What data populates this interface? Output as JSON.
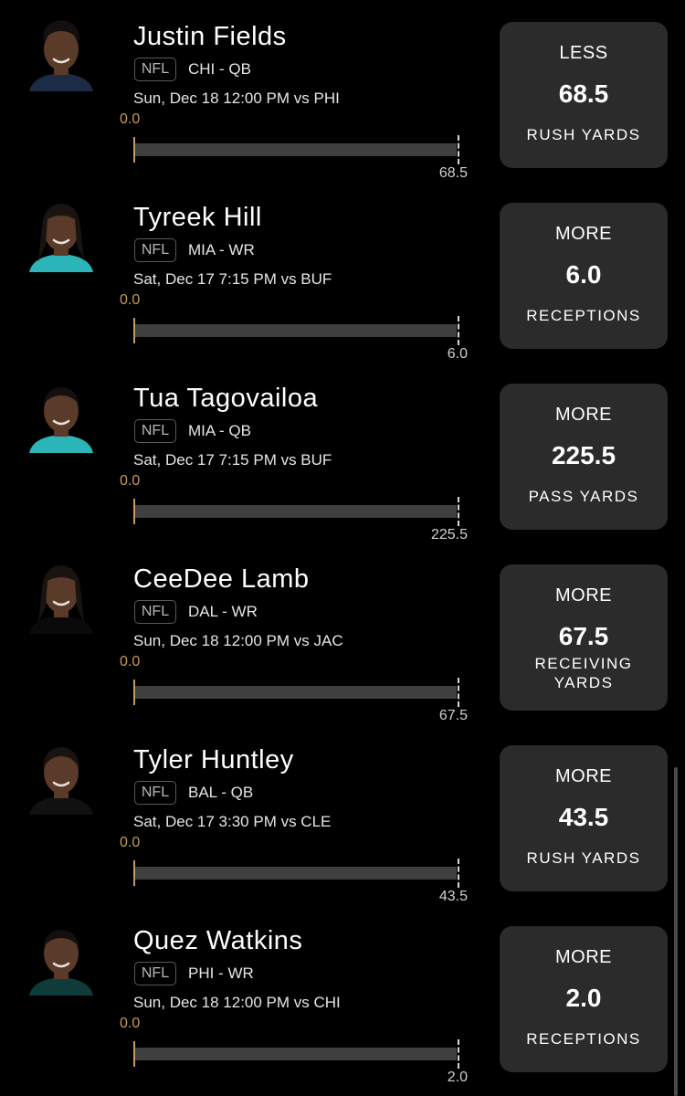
{
  "picks": [
    {
      "player": "Justin Fields",
      "league": "NFL",
      "team_position": "CHI - QB",
      "game": "Sun, Dec 18 12:00 PM  vs PHI",
      "current": "0.0",
      "target": "68.5",
      "progress": 0,
      "pick": "LESS",
      "line": "68.5",
      "stat": "RUSH YARDS",
      "jersey_color": "#1c2b46",
      "hair": "curly"
    },
    {
      "player": "Tyreek Hill",
      "league": "NFL",
      "team_position": "MIA - WR",
      "game": "Sat, Dec 17 7:15 PM  vs BUF",
      "current": "0.0",
      "target": "6.0",
      "progress": 0,
      "pick": "MORE",
      "line": "6.0",
      "stat": "RECEPTIONS",
      "jersey_color": "#2bb5b8",
      "hair": "locs"
    },
    {
      "player": "Tua Tagovailoa",
      "league": "NFL",
      "team_position": "MIA - QB",
      "game": "Sat, Dec 17 7:15 PM  vs BUF",
      "current": "0.0",
      "target": "225.5",
      "progress": 0,
      "pick": "MORE",
      "line": "225.5",
      "stat": "PASS YARDS",
      "jersey_color": "#2bb5b8",
      "hair": "short"
    },
    {
      "player": "CeeDee Lamb",
      "league": "NFL",
      "team_position": "DAL - WR",
      "game": "Sun, Dec 18 12:00 PM  vs JAC",
      "current": "0.0",
      "target": "67.5",
      "progress": 0,
      "pick": "MORE",
      "line": "67.5",
      "stat": "RECEIVING YARDS",
      "jersey_color": "#0a0a0a",
      "hair": "locs"
    },
    {
      "player": "Tyler Huntley",
      "league": "NFL",
      "team_position": "BAL - QB",
      "game": "Sat, Dec 17 3:30 PM  vs CLE",
      "current": "0.0",
      "target": "43.5",
      "progress": 0,
      "pick": "MORE",
      "line": "43.5",
      "stat": "RUSH YARDS",
      "jersey_color": "#111111",
      "hair": "braids"
    },
    {
      "player": "Quez Watkins",
      "league": "NFL",
      "team_position": "PHI - WR",
      "game": "Sun, Dec 18 12:00 PM  vs CHI",
      "current": "0.0",
      "target": "2.0",
      "progress": 0,
      "pick": "MORE",
      "line": "2.0",
      "stat": "RECEPTIONS",
      "jersey_color": "#0f3b3a",
      "hair": "short"
    }
  ],
  "colors": {
    "background": "#000000",
    "card": "#2b2b2b",
    "accent_gold": "#c99a55",
    "track": "#3f3f3f"
  }
}
